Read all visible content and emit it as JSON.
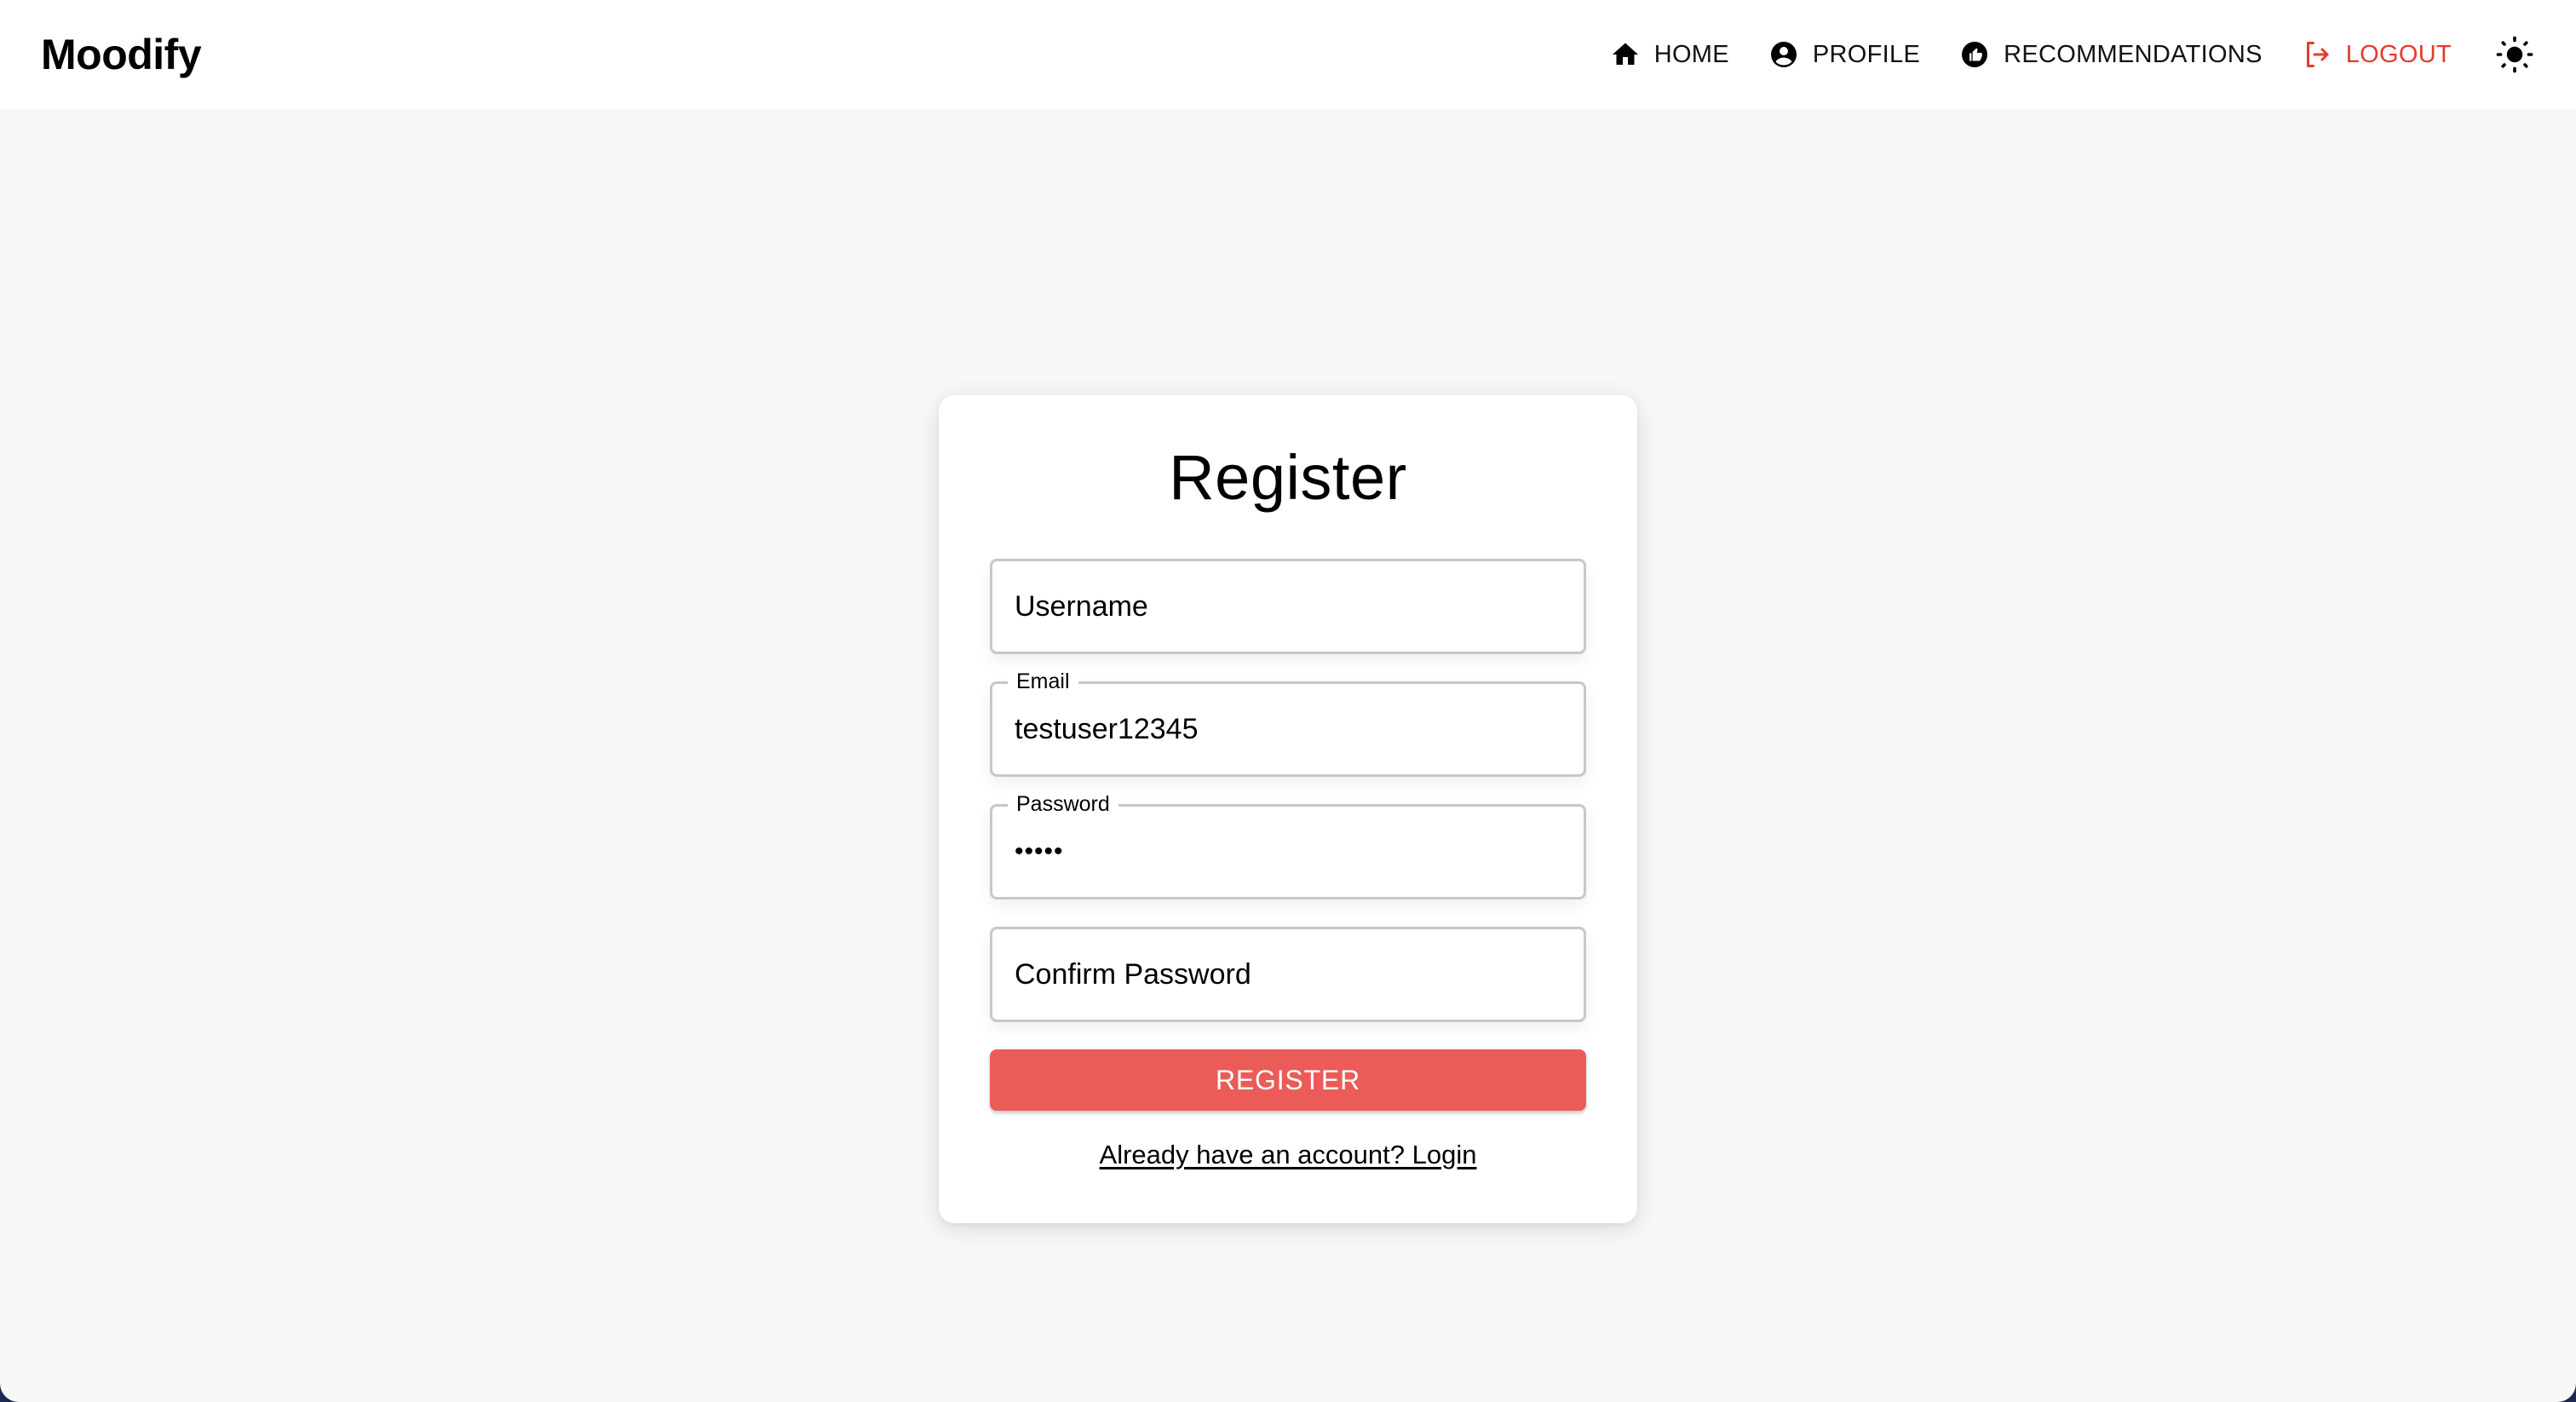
{
  "header": {
    "brand": "Moodify",
    "nav": [
      {
        "id": "home",
        "label": "HOME",
        "icon": "home-icon"
      },
      {
        "id": "profile",
        "label": "PROFILE",
        "icon": "account-circle-icon"
      },
      {
        "id": "recommendations",
        "label": "RECOMMENDATIONS",
        "icon": "thumb-up-icon"
      },
      {
        "id": "logout",
        "label": "LOGOUT",
        "icon": "logout-icon"
      }
    ],
    "theme_toggle_icon": "sun-icon"
  },
  "form": {
    "title": "Register",
    "fields": [
      {
        "id": "username",
        "label": "",
        "placeholder": "Username",
        "value": "",
        "type": "text"
      },
      {
        "id": "email",
        "label": "Email",
        "placeholder": "",
        "value": "testuser12345",
        "type": "text"
      },
      {
        "id": "password",
        "label": "Password",
        "placeholder": "",
        "value": "•••••",
        "type": "password"
      },
      {
        "id": "confirm_password",
        "label": "",
        "placeholder": "Confirm Password",
        "value": "",
        "type": "password"
      }
    ],
    "submit_label": "REGISTER",
    "login_link": "Already have an account? Login"
  },
  "colors": {
    "accent": "#eb5c58",
    "logout": "#e53a2e",
    "page_background": "#f8f8f8",
    "header_background": "#ffffff",
    "field_border": "#c7c7c7"
  }
}
